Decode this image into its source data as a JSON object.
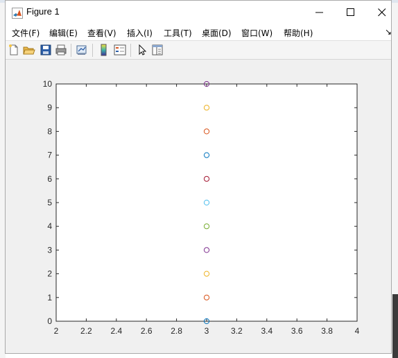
{
  "window": {
    "title": "Figure 1"
  },
  "menu": [
    "文件(F)",
    "编辑(E)",
    "查看(V)",
    "插入(I)",
    "工具(T)",
    "桌面(D)",
    "窗口(W)",
    "帮助(H)"
  ],
  "toolbar": [
    "new-figure",
    "open-file",
    "save",
    "print",
    "link-plot",
    "insert-colorbar",
    "insert-legend",
    "edit-plot",
    "property-inspector"
  ],
  "colors": {
    "blue": "#0072BD",
    "orange": "#D95319",
    "yellow": "#EDB120",
    "purple": "#7E2F8E",
    "green": "#77AC30",
    "cyan": "#4DBEEE",
    "red": "#A2142F"
  },
  "chart_data": {
    "type": "scatter",
    "marker": "o",
    "x": [
      3,
      3,
      3,
      3,
      3,
      3,
      3,
      3,
      3,
      3,
      3
    ],
    "y": [
      0,
      1,
      2,
      3,
      4,
      5,
      6,
      7,
      8,
      9,
      10
    ],
    "point_colors": [
      "#0072BD",
      "#D95319",
      "#EDB120",
      "#7E2F8E",
      "#77AC30",
      "#4DBEEE",
      "#A2142F",
      "#0072BD",
      "#D95319",
      "#EDB120",
      "#7E2F8E"
    ],
    "xlim": [
      2,
      4
    ],
    "ylim": [
      0,
      10
    ],
    "xticks": [
      "2",
      "2.2",
      "2.4",
      "2.6",
      "2.8",
      "3",
      "3.2",
      "3.4",
      "3.6",
      "3.8",
      "4"
    ],
    "yticks": [
      "0",
      "1",
      "2",
      "3",
      "4",
      "5",
      "6",
      "7",
      "8",
      "9",
      "10"
    ],
    "grid": false
  }
}
